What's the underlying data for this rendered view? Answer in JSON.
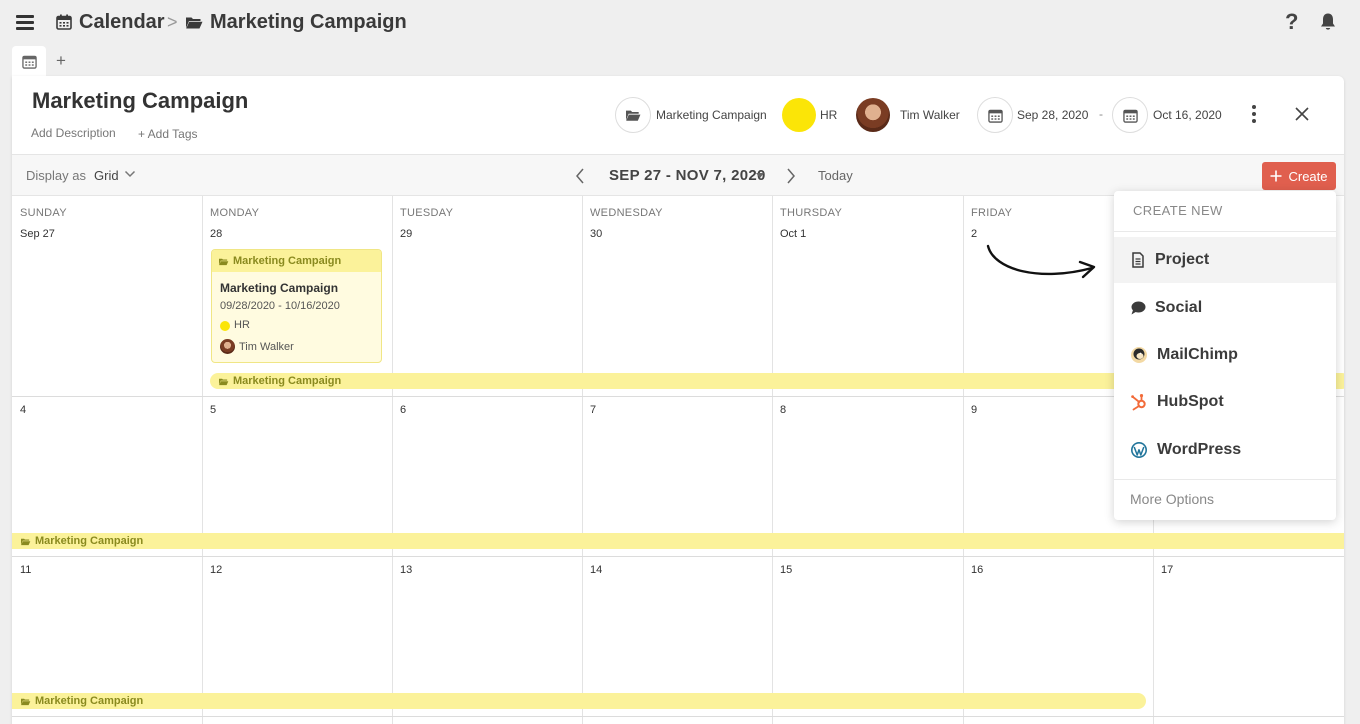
{
  "topbar": {
    "breadcrumb_1": "Calendar",
    "breadcrumb_sep": ">",
    "breadcrumb_2": "Marketing Campaign",
    "help": "?"
  },
  "tabs": {
    "add": "+"
  },
  "header": {
    "title": "Marketing Campaign",
    "add_description": "Add Description",
    "add_tags": "+ Add Tags",
    "folder": "Marketing Campaign",
    "team": "HR",
    "owner": "Tim Walker",
    "start_date": "Sep 28, 2020",
    "date_sep": "-",
    "end_date": "Oct 16, 2020"
  },
  "toolbar": {
    "display_as": "Display as",
    "view": "Grid",
    "range": "SEP 27 - NOV 7, 2020",
    "today": "Today",
    "create": "Create"
  },
  "calendar": {
    "weekdays": [
      "SUNDAY",
      "MONDAY",
      "TUESDAY",
      "WEDNESDAY",
      "THURSDAY",
      "FRIDAY"
    ],
    "week1": [
      "Sep 27",
      "28",
      "29",
      "30",
      "Oct 1",
      "2"
    ],
    "week2": [
      "4",
      "5",
      "6",
      "7",
      "8",
      "9"
    ],
    "week3": [
      "11",
      "12",
      "13",
      "14",
      "15",
      "16",
      "17"
    ],
    "band_label": "Marketing Campaign",
    "card": {
      "header": "Marketing Campaign",
      "title": "Marketing Campaign",
      "dates": "09/28/2020 - 10/16/2020",
      "team": "HR",
      "owner": "Tim Walker"
    }
  },
  "dropdown": {
    "header": "CREATE NEW",
    "items": [
      "Project",
      "Social",
      "MailChimp",
      "HubSpot",
      "WordPress"
    ],
    "more": "More Options"
  },
  "colors": {
    "accent_create": "#e05f4e",
    "campaign_band": "#fbf29a",
    "hr_yellow": "#fbe507"
  },
  "icons": [
    "menu-icon",
    "calendar-icon",
    "folder-icon",
    "help-icon",
    "bell-icon",
    "plus-icon",
    "kebab-icon",
    "close-icon",
    "chevron-left-icon",
    "chevron-right-icon",
    "document-icon",
    "speech-bubble-icon",
    "mailchimp-icon",
    "hubspot-icon",
    "wordpress-icon"
  ]
}
